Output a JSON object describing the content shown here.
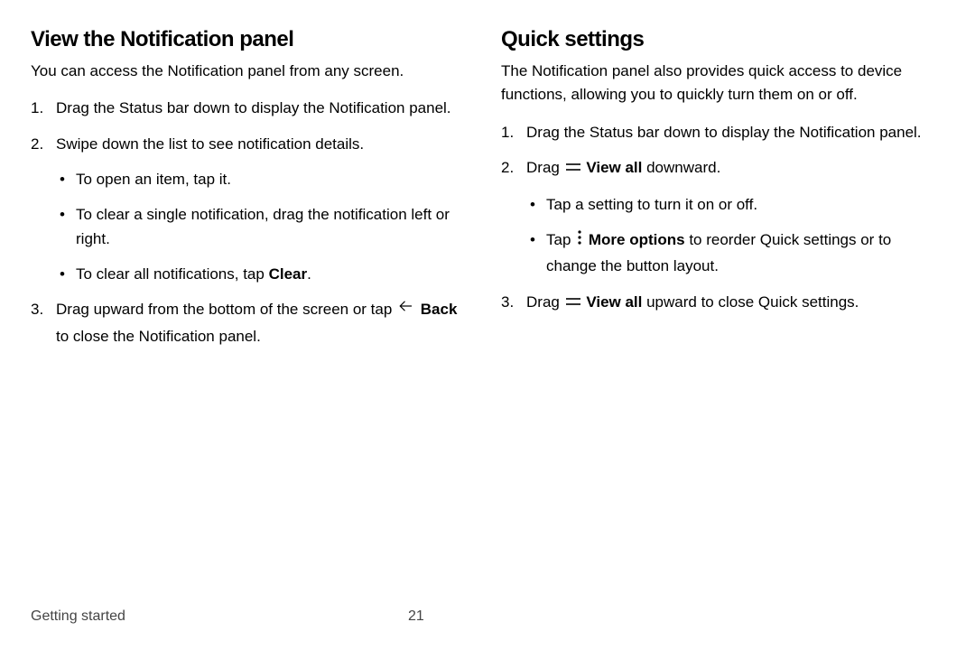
{
  "left": {
    "heading": "View the Notification panel",
    "intro": "You can access the Notification panel from any screen.",
    "step1": "Drag the Status bar down to display the Notification panel.",
    "step2": "Swipe down the list to see notification details.",
    "sub1": "To open an item, tap it.",
    "sub2": "To clear a single notification, drag the notification left or right.",
    "sub3_pre": "To clear all notifications, tap ",
    "sub3_bold": "Clear",
    "sub3_post": ".",
    "step3_pre": "Drag upward from the bottom of the screen or tap ",
    "step3_bold": "Back",
    "step3_post": " to close the Notification panel."
  },
  "right": {
    "heading": "Quick settings",
    "intro": "The Notification panel also provides quick access to device functions, allowing you to quickly turn them on or off.",
    "step1": "Drag the Status bar down to display the Notification panel.",
    "step2_pre": "Drag ",
    "step2_bold": "View all",
    "step2_post": " downward.",
    "sub1": "Tap a setting to turn it on or off.",
    "sub2_pre": "Tap ",
    "sub2_bold": "More options",
    "sub2_post": " to reorder Quick settings or to change the button layout.",
    "step3_pre": "Drag ",
    "step3_bold": "View all",
    "step3_post": " upward to close Quick settings."
  },
  "footer": {
    "section": "Getting started",
    "page": "21"
  }
}
